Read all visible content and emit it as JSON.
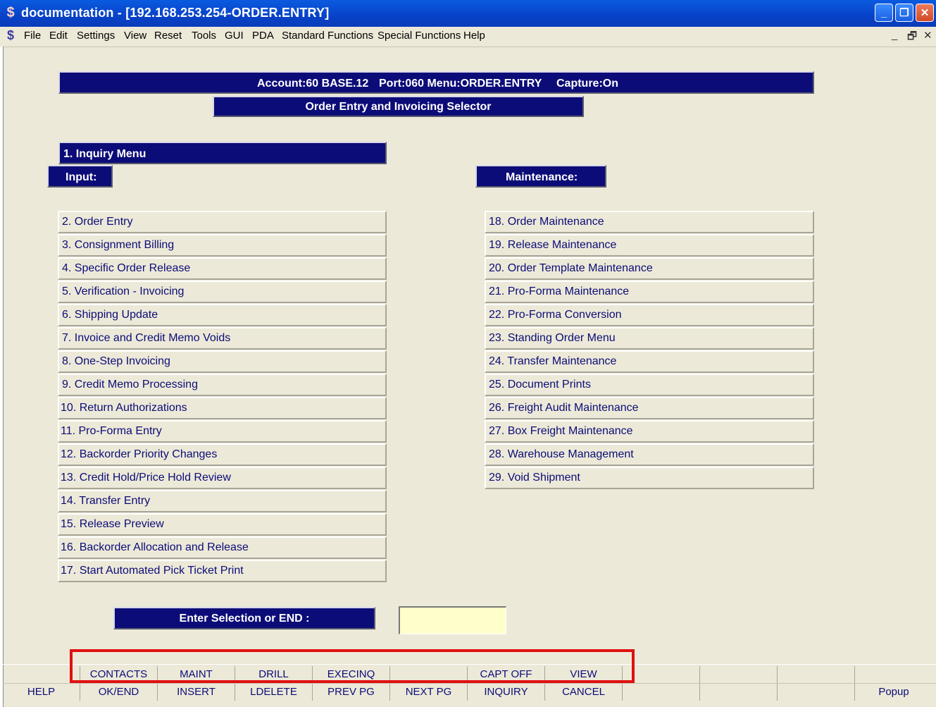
{
  "window": {
    "title": "documentation - [192.168.253.254-ORDER.ENTRY]",
    "minimize": "_",
    "restore": "❐",
    "close": "✕"
  },
  "menubar": {
    "items": [
      "File",
      "Edit",
      "Settings",
      "View",
      "Reset",
      "Tools",
      "GUI",
      "PDA",
      "Standard Functions",
      "Special Functions",
      "Help"
    ],
    "mdi_min": "_",
    "mdi_restore": "🗗",
    "mdi_close": "✕"
  },
  "header": {
    "account": "Account:60 BASE.12",
    "port_menu": "Port:060 Menu:ORDER.ENTRY",
    "capture": "Capture:On",
    "subtitle": "Order Entry and Invoicing Selector"
  },
  "sections": {
    "inquiry": "1. Inquiry Menu",
    "input": "Input:",
    "maintenance": "Maintenance:"
  },
  "input_items": [
    "2. Order Entry",
    "3. Consignment Billing",
    "4. Specific Order Release",
    "5. Verification - Invoicing",
    "6. Shipping Update",
    "7. Invoice and Credit Memo Voids",
    "8. One-Step Invoicing",
    "9. Credit Memo Processing",
    "10. Return Authorizations",
    "11. Pro-Forma Entry",
    "12. Backorder Priority Changes",
    "13. Credit Hold/Price Hold Review",
    "14. Transfer Entry",
    "15. Release Preview",
    "16. Backorder Allocation and Release",
    "17. Start Automated Pick Ticket Print"
  ],
  "maintenance_items": [
    "18. Order Maintenance",
    "19. Release Maintenance",
    "20. Order Template Maintenance",
    "21. Pro-Forma Maintenance",
    "22. Pro-Forma Conversion",
    "23. Standing Order Menu",
    "24. Transfer Maintenance",
    "25. Document Prints",
    "26. Freight Audit Maintenance",
    "27. Box Freight Maintenance",
    "28. Warehouse Management",
    "29. Void Shipment"
  ],
  "selection": {
    "label": "Enter Selection or END :",
    "value": ""
  },
  "function_keys": {
    "row1": [
      "",
      "CONTACTS",
      "MAINT",
      "DRILL",
      "EXECINQ",
      "",
      "CAPT OFF",
      "VIEW",
      "",
      "",
      "",
      ""
    ],
    "row2": [
      "HELP",
      "OK/END",
      "INSERT",
      "LDELETE",
      "PREV PG",
      "NEXT PG",
      "INQUIRY",
      "CANCEL",
      "",
      "",
      "",
      "Popup"
    ]
  }
}
